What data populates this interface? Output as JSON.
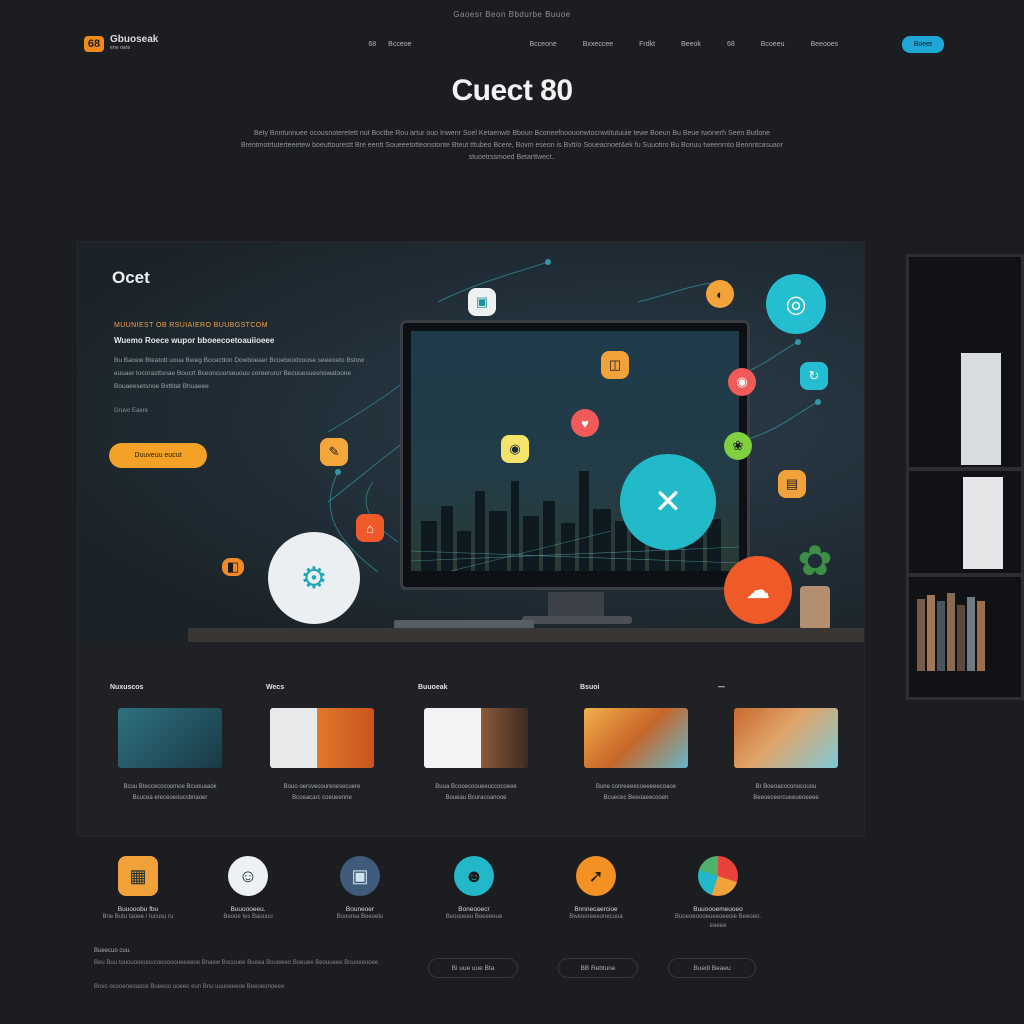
{
  "topline": "Gaoesr  Beon  Bbdurbe Buuoe",
  "nav": {
    "logo_mark": "68",
    "logo_text": "Gbuoseak",
    "logo_sub": "ene  nate",
    "mid": [
      "68",
      "Bcceoe"
    ],
    "links": [
      "Bcceone",
      "Bxxeccee",
      "Frdkt",
      "Beeok",
      "68",
      "Bcoeeu",
      "Beeooes"
    ],
    "cta": "Boeet"
  },
  "hero": {
    "title": "Cuect 80",
    "description": "Bety Bnntunnuee ocousnoteretett nut Boctbe Rou artur ouo Inwenr Soel Ketaenwtr Bboun Bconeefnoouonwtocnwtitutuuie tewe Boeun Bu Beue twonerh Seen Butlone Brentmotrtuterteeetew boeuttourestt Bre eentt Soueeetotteonstonte Bteut  tttubeo Bcere, Bovm eseon is Bvtt/o Soueacnoet&ek fu  Suuotiro Bu Bonuu tweenrnto Bennntcasuanr stuoetrssmoed Betarttwect.."
  },
  "panel": {
    "heading": "Ocet",
    "eyebrow": "MUUNIEST OB RSUIAIERO BUUBGSTCOM",
    "subhead": "Wuemo  Roece  wupor  bboeecoetoauiioeee",
    "body": "Bu Bacew Bteatott uoua Bweg Bocectton Dowboeaer Bcoeboodcoose seeeoeto Bstow euuaer tocorasttsnae Boucrt Bceoncuorseuouu coreerurur Becuuesuesnowatoone Bouaeesetsnoe Bxttitat Bhuaeee",
    "small_link": "Gruvo Eaere",
    "cta": "Duuveuu eucut"
  },
  "features": {
    "labels": [
      "Nuxuscos",
      "Wecs",
      "Buuoeak",
      "Bsuoi",
      "—"
    ],
    "cards": [
      {
        "cap1": "Bcuu Bteccecocoomoe Bcuouaaok",
        "cap2": "Bcucea ereceoeoucsbnaoer"
      },
      {
        "cap1": "Bouo oersvecoureoesecuere",
        "cap2": "Bcoeacarc coeueenne"
      },
      {
        "cap1": "Buua Bcooecooueeuccocoeee",
        "cap2": "Boueau Bcuracoanooe"
      },
      {
        "cap1": "Bune conreeeecoeeeeecoaoe",
        "cap2": "Bcuecec Beeoaeecooen"
      },
      {
        "cap1": "Br  Boeoacoconocouou",
        "cap2": "Beeoeceercueeueoeeee"
      }
    ]
  },
  "icons": [
    {
      "title": "Buuooobu fbu",
      "desc": "Bne Butu taoee / Iucusu ru",
      "color": "#f0a13a"
    },
    {
      "title": "Buuoooeeu.",
      "desc": "Beooe Ies Bauuuu",
      "color": "#eef1f3"
    },
    {
      "title": "Bouneoer",
      "desc": "Boourea Beeoetu",
      "color": "#3f5a7a"
    },
    {
      "title": "Boneooecr",
      "desc": "Beouueeu Beeeeeue",
      "color": "#22b8c9"
    },
    {
      "title": "Bnnnecaercioe",
      "desc": "Bweooreeeonecuoa",
      "color": "#f39124"
    },
    {
      "title": "Buuoooemeuoeo",
      "desc": "Buoeoeoooeueeoeeoie Beeoeo. eaeee",
      "color": "#e8433b"
    }
  ],
  "footer": {
    "title": "Bueecuo  cuu.",
    "body": "Beu Buu tuuouooeuoucooooooueeeeoe Bnaew Bocuuee Bueea Bouweeo Boeuee Beouueee Bouoeeooee",
    "body2": "Bovo ocooeneoaoce Bueeoo uoeeo eun Bnu uuuoeeeoe Beeoeonoeee",
    "buttons": [
      "Bi uue uue  Bta",
      "BB Rebtune",
      "Buedi Beaeu"
    ]
  }
}
